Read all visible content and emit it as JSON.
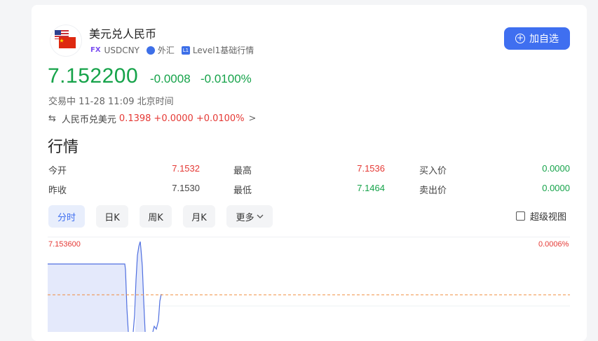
{
  "header": {
    "title": "美元兑人民币",
    "fx_badge": "FX",
    "code": "USDCNY",
    "market": "外汇",
    "level_badge": "L1",
    "level_text": "Level1基础行情",
    "add_button": "加自选"
  },
  "quote": {
    "price": "7.152200",
    "change": "-0.0008",
    "change_pct": "-0.0100%",
    "status": "交易中 11-28 11:09 北京时间"
  },
  "inverse": {
    "swap_icon": "⇆",
    "label": "人民币兑美元",
    "price": "0.1398",
    "change": "+0.0000",
    "change_pct": "+0.0100%",
    "chevron": ">"
  },
  "market_section": {
    "title": "行情",
    "rows": [
      {
        "label1": "今开",
        "value1": "7.1532",
        "label2": "最高",
        "value2": "7.1536",
        "label3": "买入价",
        "value3": "0.0000"
      },
      {
        "label1": "昨收",
        "value1": "7.1530",
        "label2": "最低",
        "value2": "7.1464",
        "label3": "卖出价",
        "value3": "0.0000"
      }
    ]
  },
  "tabs": [
    "分时",
    "日K",
    "周K",
    "月K",
    "更多"
  ],
  "active_tab": "分时",
  "super_view": "超级视图",
  "chart": {
    "y_top_label": "7.153600",
    "pct_top_label": "0.0006%",
    "prev_close": "7.1530",
    "line_color": "#4f6fe0",
    "fill_color": "#e4e9fb",
    "ref_line_color": "#f08c3c"
  },
  "colors": {
    "accent": "#3f6ff0",
    "up": "#e53935",
    "down": "#16a34a"
  }
}
